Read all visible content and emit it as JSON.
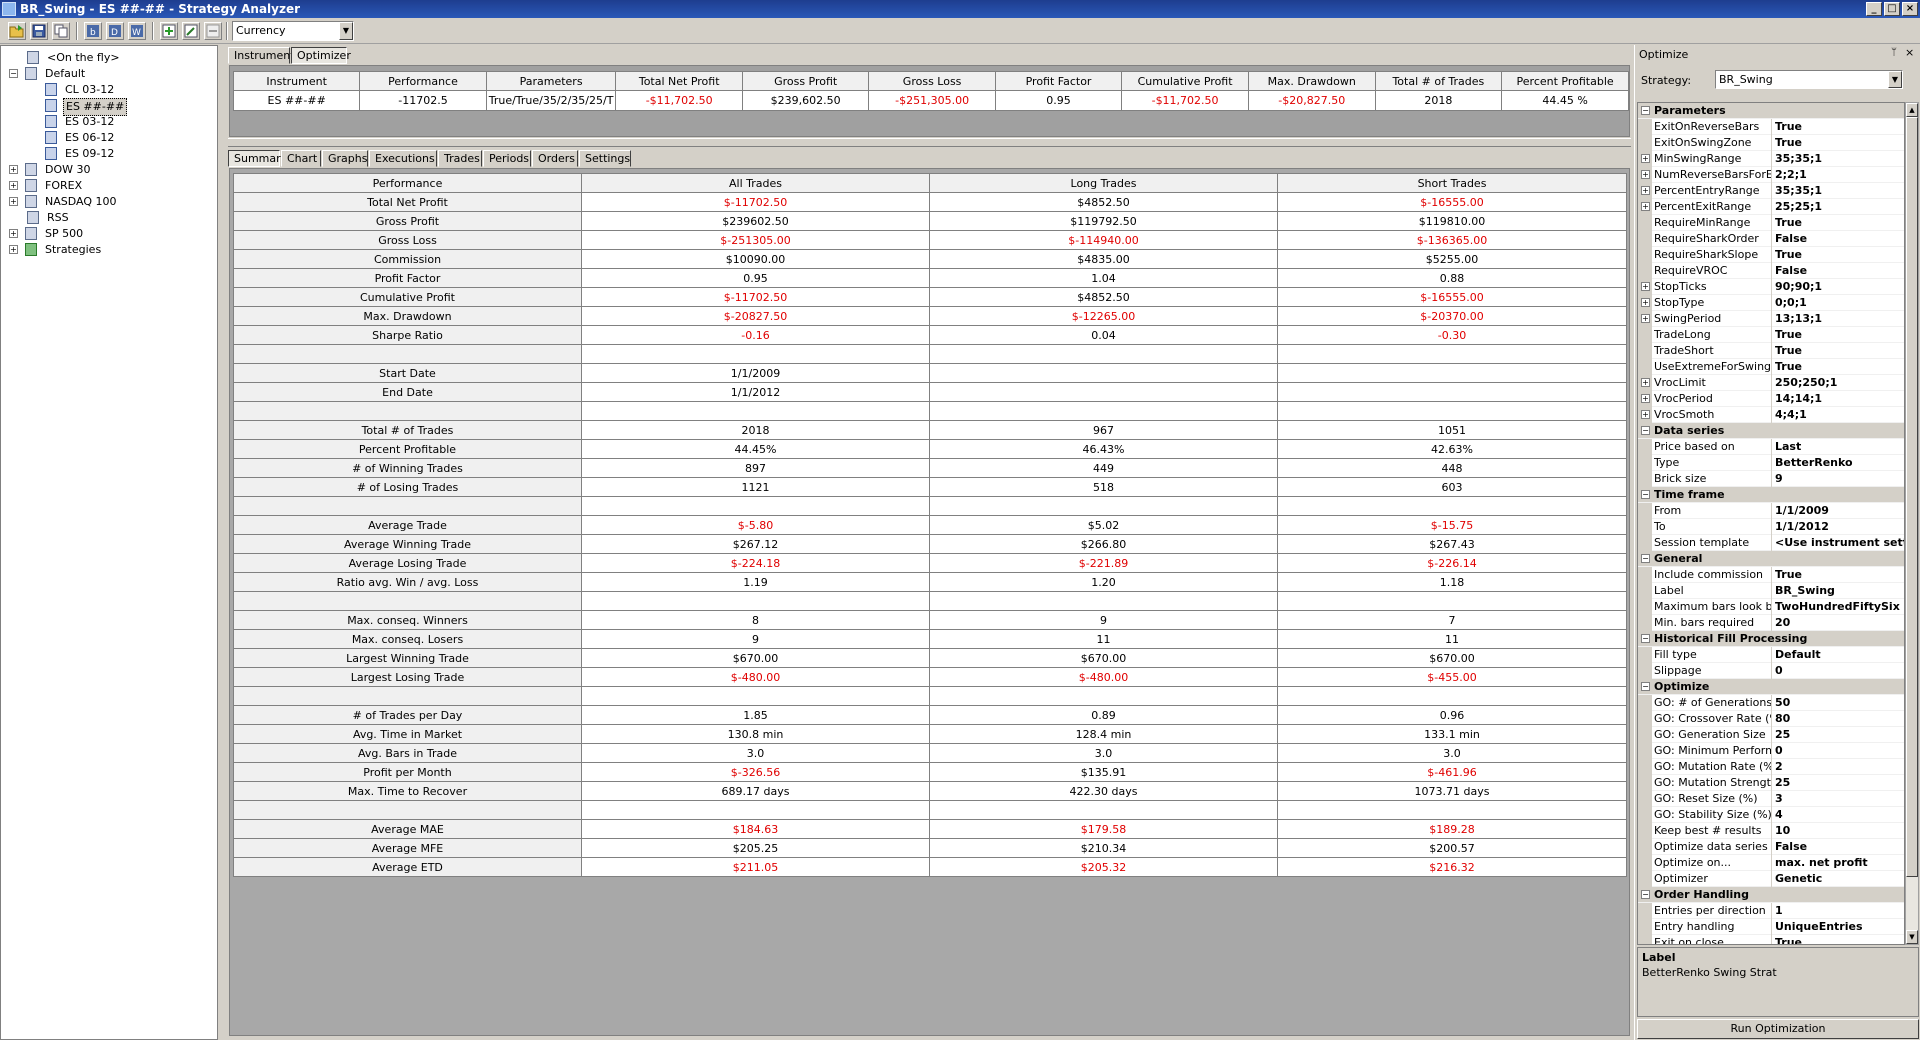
{
  "window": {
    "title": "BR_Swing - ES ##-## - Strategy Analyzer",
    "buttons": [
      "_",
      "□",
      "×"
    ]
  },
  "toolbar": {
    "currency": "Currency",
    "icons": [
      "open-folder-icon",
      "save-icon",
      "copy-icon",
      "bar-chart-icon",
      "d-icon",
      "w-icon",
      "add-icon",
      "edit-icon",
      "remove-icon"
    ]
  },
  "tree": [
    {
      "label": "<On the fly>",
      "indent": 1,
      "expand": "",
      "icon": "list",
      "selected": false
    },
    {
      "label": "Default",
      "indent": 0,
      "expand": "−",
      "icon": "list",
      "selected": false
    },
    {
      "label": "CL 03-12",
      "indent": 2,
      "expand": "",
      "icon": "instrument",
      "selected": false
    },
    {
      "label": "ES ##-##",
      "indent": 2,
      "expand": "",
      "icon": "instrument",
      "selected": true
    },
    {
      "label": "ES 03-12",
      "indent": 2,
      "expand": "",
      "icon": "instrument",
      "selected": false
    },
    {
      "label": "ES 06-12",
      "indent": 2,
      "expand": "",
      "icon": "instrument",
      "selected": false
    },
    {
      "label": "ES 09-12",
      "indent": 2,
      "expand": "",
      "icon": "instrument",
      "selected": false
    },
    {
      "label": "DOW 30",
      "indent": 0,
      "expand": "+",
      "icon": "list",
      "selected": false
    },
    {
      "label": "FOREX",
      "indent": 0,
      "expand": "+",
      "icon": "list",
      "selected": false
    },
    {
      "label": "NASDAQ 100",
      "indent": 0,
      "expand": "+",
      "icon": "list",
      "selected": false
    },
    {
      "label": "RSS",
      "indent": 1,
      "expand": "",
      "icon": "list",
      "selected": false
    },
    {
      "label": "SP 500",
      "indent": 0,
      "expand": "+",
      "icon": "list",
      "selected": false
    },
    {
      "label": "Strategies",
      "indent": 0,
      "expand": "+",
      "icon": "strategy",
      "selected": false
    }
  ],
  "instrument_tabs": [
    "Instruments",
    "Optimizer"
  ],
  "instrument_table": {
    "headers": [
      "Instrument",
      "Performance",
      "Parameters",
      "Total Net Profit",
      "Gross Profit",
      "Gross Loss",
      "Profit Factor",
      "Cumulative Profit",
      "Max. Drawdown",
      "Total # of Trades",
      "Percent Profitable"
    ],
    "rows": [
      [
        {
          "v": "ES ##-##",
          "neg": false
        },
        {
          "v": "-11702.5",
          "neg": false
        },
        {
          "v": "True/True/35/2/35/25/T",
          "neg": false
        },
        {
          "v": "-$11,702.50",
          "neg": true
        },
        {
          "v": "$239,602.50",
          "neg": false
        },
        {
          "v": "-$251,305.00",
          "neg": true
        },
        {
          "v": "0.95",
          "neg": false
        },
        {
          "v": "-$11,702.50",
          "neg": true
        },
        {
          "v": "-$20,827.50",
          "neg": true
        },
        {
          "v": "2018",
          "neg": false
        },
        {
          "v": "44.45 %",
          "neg": false
        }
      ]
    ]
  },
  "summary_tabs": [
    "Summary",
    "Chart",
    "Graphs",
    "Executions",
    "Trades",
    "Periods",
    "Orders",
    "Settings"
  ],
  "summary_table": {
    "headers": [
      "Performance",
      "All Trades",
      "Long Trades",
      "Short Trades"
    ],
    "rows": [
      [
        {
          "v": "Total Net Profit"
        },
        {
          "v": "$-11702.50",
          "neg": true
        },
        {
          "v": "$4852.50"
        },
        {
          "v": "$-16555.00",
          "neg": true
        }
      ],
      [
        {
          "v": "Gross Profit"
        },
        {
          "v": "$239602.50"
        },
        {
          "v": "$119792.50"
        },
        {
          "v": "$119810.00"
        }
      ],
      [
        {
          "v": "Gross Loss"
        },
        {
          "v": "$-251305.00",
          "neg": true
        },
        {
          "v": "$-114940.00",
          "neg": true
        },
        {
          "v": "$-136365.00",
          "neg": true
        }
      ],
      [
        {
          "v": "Commission"
        },
        {
          "v": "$10090.00"
        },
        {
          "v": "$4835.00"
        },
        {
          "v": "$5255.00"
        }
      ],
      [
        {
          "v": "Profit Factor"
        },
        {
          "v": "0.95"
        },
        {
          "v": "1.04"
        },
        {
          "v": "0.88"
        }
      ],
      [
        {
          "v": "Cumulative Profit"
        },
        {
          "v": "$-11702.50",
          "neg": true
        },
        {
          "v": "$4852.50"
        },
        {
          "v": "$-16555.00",
          "neg": true
        }
      ],
      [
        {
          "v": "Max. Drawdown"
        },
        {
          "v": "$-20827.50",
          "neg": true
        },
        {
          "v": "$-12265.00",
          "neg": true
        },
        {
          "v": "$-20370.00",
          "neg": true
        }
      ],
      [
        {
          "v": "Sharpe Ratio"
        },
        {
          "v": "-0.16",
          "neg": true
        },
        {
          "v": "0.04"
        },
        {
          "v": "-0.30",
          "neg": true
        }
      ],
      [
        {
          "v": ""
        },
        {
          "v": ""
        },
        {
          "v": ""
        },
        {
          "v": ""
        }
      ],
      [
        {
          "v": "Start Date"
        },
        {
          "v": "1/1/2009"
        },
        {
          "v": ""
        },
        {
          "v": ""
        }
      ],
      [
        {
          "v": "End Date"
        },
        {
          "v": "1/1/2012"
        },
        {
          "v": ""
        },
        {
          "v": ""
        }
      ],
      [
        {
          "v": ""
        },
        {
          "v": ""
        },
        {
          "v": ""
        },
        {
          "v": ""
        }
      ],
      [
        {
          "v": "Total # of Trades"
        },
        {
          "v": "2018"
        },
        {
          "v": "967"
        },
        {
          "v": "1051"
        }
      ],
      [
        {
          "v": "Percent Profitable"
        },
        {
          "v": "44.45%"
        },
        {
          "v": "46.43%"
        },
        {
          "v": "42.63%"
        }
      ],
      [
        {
          "v": "# of Winning Trades"
        },
        {
          "v": "897"
        },
        {
          "v": "449"
        },
        {
          "v": "448"
        }
      ],
      [
        {
          "v": "# of Losing Trades"
        },
        {
          "v": "1121"
        },
        {
          "v": "518"
        },
        {
          "v": "603"
        }
      ],
      [
        {
          "v": ""
        },
        {
          "v": ""
        },
        {
          "v": ""
        },
        {
          "v": ""
        }
      ],
      [
        {
          "v": "Average Trade"
        },
        {
          "v": "$-5.80",
          "neg": true
        },
        {
          "v": "$5.02"
        },
        {
          "v": "$-15.75",
          "neg": true
        }
      ],
      [
        {
          "v": "Average Winning Trade"
        },
        {
          "v": "$267.12"
        },
        {
          "v": "$266.80"
        },
        {
          "v": "$267.43"
        }
      ],
      [
        {
          "v": "Average Losing Trade"
        },
        {
          "v": "$-224.18",
          "neg": true
        },
        {
          "v": "$-221.89",
          "neg": true
        },
        {
          "v": "$-226.14",
          "neg": true
        }
      ],
      [
        {
          "v": "Ratio avg. Win / avg. Loss"
        },
        {
          "v": "1.19"
        },
        {
          "v": "1.20"
        },
        {
          "v": "1.18"
        }
      ],
      [
        {
          "v": ""
        },
        {
          "v": ""
        },
        {
          "v": ""
        },
        {
          "v": ""
        }
      ],
      [
        {
          "v": "Max. conseq. Winners"
        },
        {
          "v": "8"
        },
        {
          "v": "9"
        },
        {
          "v": "7"
        }
      ],
      [
        {
          "v": "Max. conseq. Losers"
        },
        {
          "v": "9"
        },
        {
          "v": "11"
        },
        {
          "v": "11"
        }
      ],
      [
        {
          "v": "Largest Winning Trade"
        },
        {
          "v": "$670.00"
        },
        {
          "v": "$670.00"
        },
        {
          "v": "$670.00"
        }
      ],
      [
        {
          "v": "Largest Losing Trade"
        },
        {
          "v": "$-480.00",
          "neg": true
        },
        {
          "v": "$-480.00",
          "neg": true
        },
        {
          "v": "$-455.00",
          "neg": true
        }
      ],
      [
        {
          "v": ""
        },
        {
          "v": ""
        },
        {
          "v": ""
        },
        {
          "v": ""
        }
      ],
      [
        {
          "v": "# of Trades per Day"
        },
        {
          "v": "1.85"
        },
        {
          "v": "0.89"
        },
        {
          "v": "0.96"
        }
      ],
      [
        {
          "v": "Avg. Time in Market"
        },
        {
          "v": "130.8 min"
        },
        {
          "v": "128.4 min"
        },
        {
          "v": "133.1 min"
        }
      ],
      [
        {
          "v": "Avg. Bars in Trade"
        },
        {
          "v": "3.0"
        },
        {
          "v": "3.0"
        },
        {
          "v": "3.0"
        }
      ],
      [
        {
          "v": "Profit per Month"
        },
        {
          "v": "$-326.56",
          "neg": true
        },
        {
          "v": "$135.91"
        },
        {
          "v": "$-461.96",
          "neg": true
        }
      ],
      [
        {
          "v": "Max. Time to Recover"
        },
        {
          "v": "689.17 days"
        },
        {
          "v": "422.30 days"
        },
        {
          "v": "1073.71 days"
        }
      ],
      [
        {
          "v": ""
        },
        {
          "v": ""
        },
        {
          "v": ""
        },
        {
          "v": ""
        }
      ],
      [
        {
          "v": "Average MAE"
        },
        {
          "v": "$184.63",
          "neg": true
        },
        {
          "v": "$179.58",
          "neg": true
        },
        {
          "v": "$189.28",
          "neg": true
        }
      ],
      [
        {
          "v": "Average MFE"
        },
        {
          "v": "$205.25"
        },
        {
          "v": "$210.34"
        },
        {
          "v": "$200.57"
        }
      ],
      [
        {
          "v": "Average ETD"
        },
        {
          "v": "$211.05",
          "neg": true
        },
        {
          "v": "$205.32",
          "neg": true
        },
        {
          "v": "$216.32",
          "neg": true
        }
      ]
    ]
  },
  "optimize": {
    "title": "Optimize",
    "pin": "📌",
    "close": "×",
    "strategy_label": "Strategy:",
    "strategy_value": "BR_Swing",
    "grid": [
      {
        "cat": "Parameters"
      },
      {
        "name": "ExitOnReverseBars",
        "value": "True"
      },
      {
        "name": "ExitOnSwingZone",
        "value": "True"
      },
      {
        "name": "MinSwingRange",
        "value": "35;35;1",
        "exp": true
      },
      {
        "name": "NumReverseBarsForExit",
        "value": "2;2;1",
        "exp": true
      },
      {
        "name": "PercentEntryRange",
        "value": "35;35;1",
        "exp": true
      },
      {
        "name": "PercentExitRange",
        "value": "25;25;1",
        "exp": true
      },
      {
        "name": "RequireMinRange",
        "value": "True"
      },
      {
        "name": "RequireSharkOrder",
        "value": "False"
      },
      {
        "name": "RequireSharkSlope",
        "value": "True"
      },
      {
        "name": "RequireVROC",
        "value": "False"
      },
      {
        "name": "StopTicks",
        "value": "90;90;1",
        "exp": true
      },
      {
        "name": "StopType",
        "value": "0;0;1",
        "exp": true
      },
      {
        "name": "SwingPeriod",
        "value": "13;13;1",
        "exp": true
      },
      {
        "name": "TradeLong",
        "value": "True"
      },
      {
        "name": "TradeShort",
        "value": "True"
      },
      {
        "name": "UseExtremeForSwingZone",
        "value": "True"
      },
      {
        "name": "VrocLimit",
        "value": "250;250;1",
        "exp": true
      },
      {
        "name": "VrocPeriod",
        "value": "14;14;1",
        "exp": true
      },
      {
        "name": "VrocSmoth",
        "value": "4;4;1",
        "exp": true
      },
      {
        "cat": "Data series"
      },
      {
        "name": "Price based on",
        "value": "Last"
      },
      {
        "name": "Type",
        "value": "BetterRenko"
      },
      {
        "name": "Brick size",
        "value": "9"
      },
      {
        "cat": "Time frame"
      },
      {
        "name": "From",
        "value": "1/1/2009"
      },
      {
        "name": "To",
        "value": "1/1/2012"
      },
      {
        "name": "Session template",
        "value": "<Use instrument settings>"
      },
      {
        "cat": "General"
      },
      {
        "name": "Include commission",
        "value": "True"
      },
      {
        "name": "Label",
        "value": "BR_Swing"
      },
      {
        "name": "Maximum bars look back",
        "value": "TwoHundredFiftySix"
      },
      {
        "name": "Min. bars required",
        "value": "20"
      },
      {
        "cat": "Historical Fill Processing"
      },
      {
        "name": "Fill type",
        "value": "Default"
      },
      {
        "name": "Slippage",
        "value": "0"
      },
      {
        "cat": "Optimize"
      },
      {
        "name": "GO: # of Generations",
        "value": "50"
      },
      {
        "name": "GO: Crossover Rate (%)",
        "value": "80"
      },
      {
        "name": "GO: Generation Size",
        "value": "25"
      },
      {
        "name": "GO: Minimum Performance",
        "value": "0"
      },
      {
        "name": "GO: Mutation Rate (%)",
        "value": "2"
      },
      {
        "name": "GO: Mutation Strength (%)",
        "value": "25"
      },
      {
        "name": "GO: Reset Size (%)",
        "value": "3"
      },
      {
        "name": "GO: Stability Size (%)",
        "value": "4"
      },
      {
        "name": "Keep best # results",
        "value": "10"
      },
      {
        "name": "Optimize data series",
        "value": "False"
      },
      {
        "name": "Optimize on...",
        "value": "max. net profit"
      },
      {
        "name": "Optimizer",
        "value": "Genetic"
      },
      {
        "cat": "Order Handling"
      },
      {
        "name": "Entries per direction",
        "value": "1"
      },
      {
        "name": "Entry handling",
        "value": "UniqueEntries"
      },
      {
        "name": "Exit on close",
        "value": "True"
      }
    ],
    "desc_title": "Label",
    "desc_text": "BetterRenko Swing Strat",
    "run_button": "Run Optimization"
  },
  "colors": {
    "negative": "#e00000",
    "title_bar": "#1e3d8f",
    "panel_bg": "#a8a8a8"
  }
}
